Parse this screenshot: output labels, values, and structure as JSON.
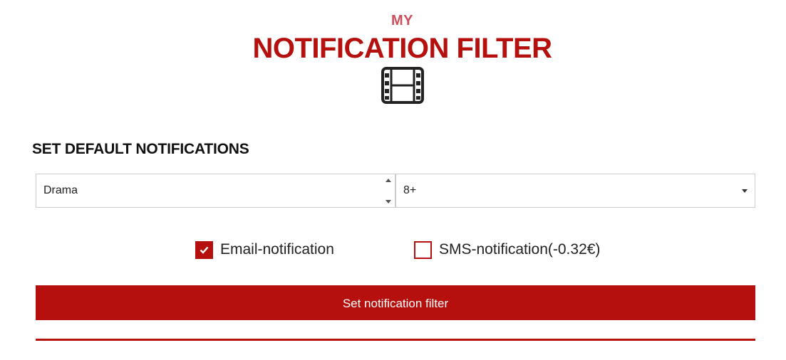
{
  "header": {
    "kicker": "MY",
    "title": "NOTIFICATION FILTER",
    "icon": "film-icon"
  },
  "section": {
    "title": "SET DEFAULT NOTIFICATIONS"
  },
  "filters": {
    "genre": {
      "selected": "Drama"
    },
    "age": {
      "selected": "8+"
    }
  },
  "options": {
    "email": {
      "label": "Email-notification",
      "checked": true
    },
    "sms": {
      "label": "SMS-notification(-0.32€)",
      "checked": false
    }
  },
  "actions": {
    "submit_label": "Set notification filter"
  },
  "colors": {
    "accent": "#b5100e",
    "kicker": "#cc4f5c",
    "border": "#cccccc"
  }
}
